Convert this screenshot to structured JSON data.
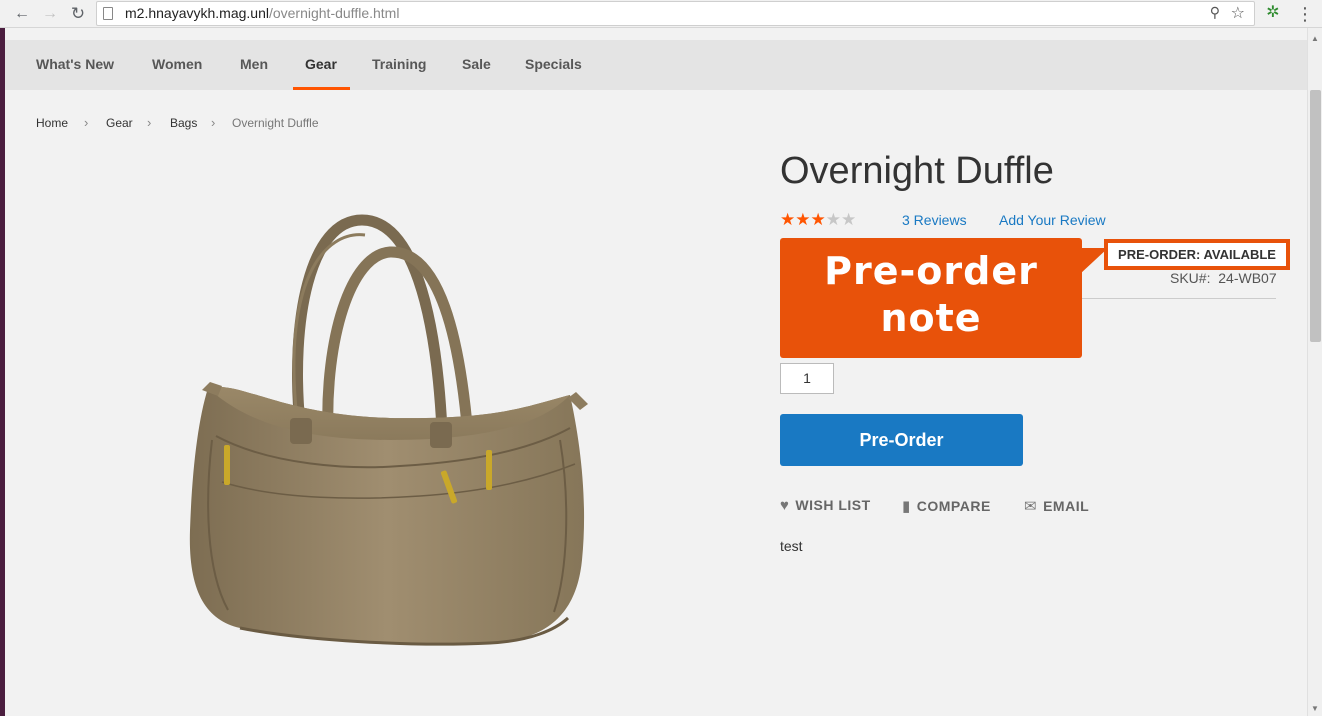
{
  "browser": {
    "url_host": "m2.hnayavykh.mag.unl",
    "url_path": "/overnight-duffle.html",
    "back_icon": "←",
    "forward_icon": "→",
    "reload_icon": "↻",
    "menu_icon": "⋮",
    "key_icon": "⚲",
    "star_icon": "☆",
    "ext_icon": "✲"
  },
  "nav": {
    "items": [
      {
        "label": "What's New"
      },
      {
        "label": "Women"
      },
      {
        "label": "Men"
      },
      {
        "label": "Gear"
      },
      {
        "label": "Training"
      },
      {
        "label": "Sale"
      },
      {
        "label": "Specials"
      }
    ],
    "active_index": 3,
    "accent": "#ff5501"
  },
  "breadcrumbs": {
    "items": [
      "Home",
      "Gear",
      "Bags",
      "Overnight Duffle"
    ],
    "separator": "›"
  },
  "product": {
    "title": "Overnight Duffle",
    "rating": {
      "value": 3,
      "out_of": 5
    },
    "reviews_link": "3 Reviews",
    "add_review_link": "Add Your Review",
    "preorder_badge": "PRE-ORDER: AVAILABLE",
    "sku_label": "SKU#:",
    "sku_value": "24-WB07",
    "qty": "1",
    "preorder_button": "Pre-Order",
    "description": "test"
  },
  "callout": {
    "line1": "Pre-order",
    "line2": "note",
    "color": "#e8520a"
  },
  "actions": {
    "wishlist": "WISH LIST",
    "compare": "COMPARE",
    "email": "EMAIL"
  },
  "colors": {
    "link": "#1979c3",
    "button": "#1979c3",
    "star_on": "#ff5501"
  }
}
